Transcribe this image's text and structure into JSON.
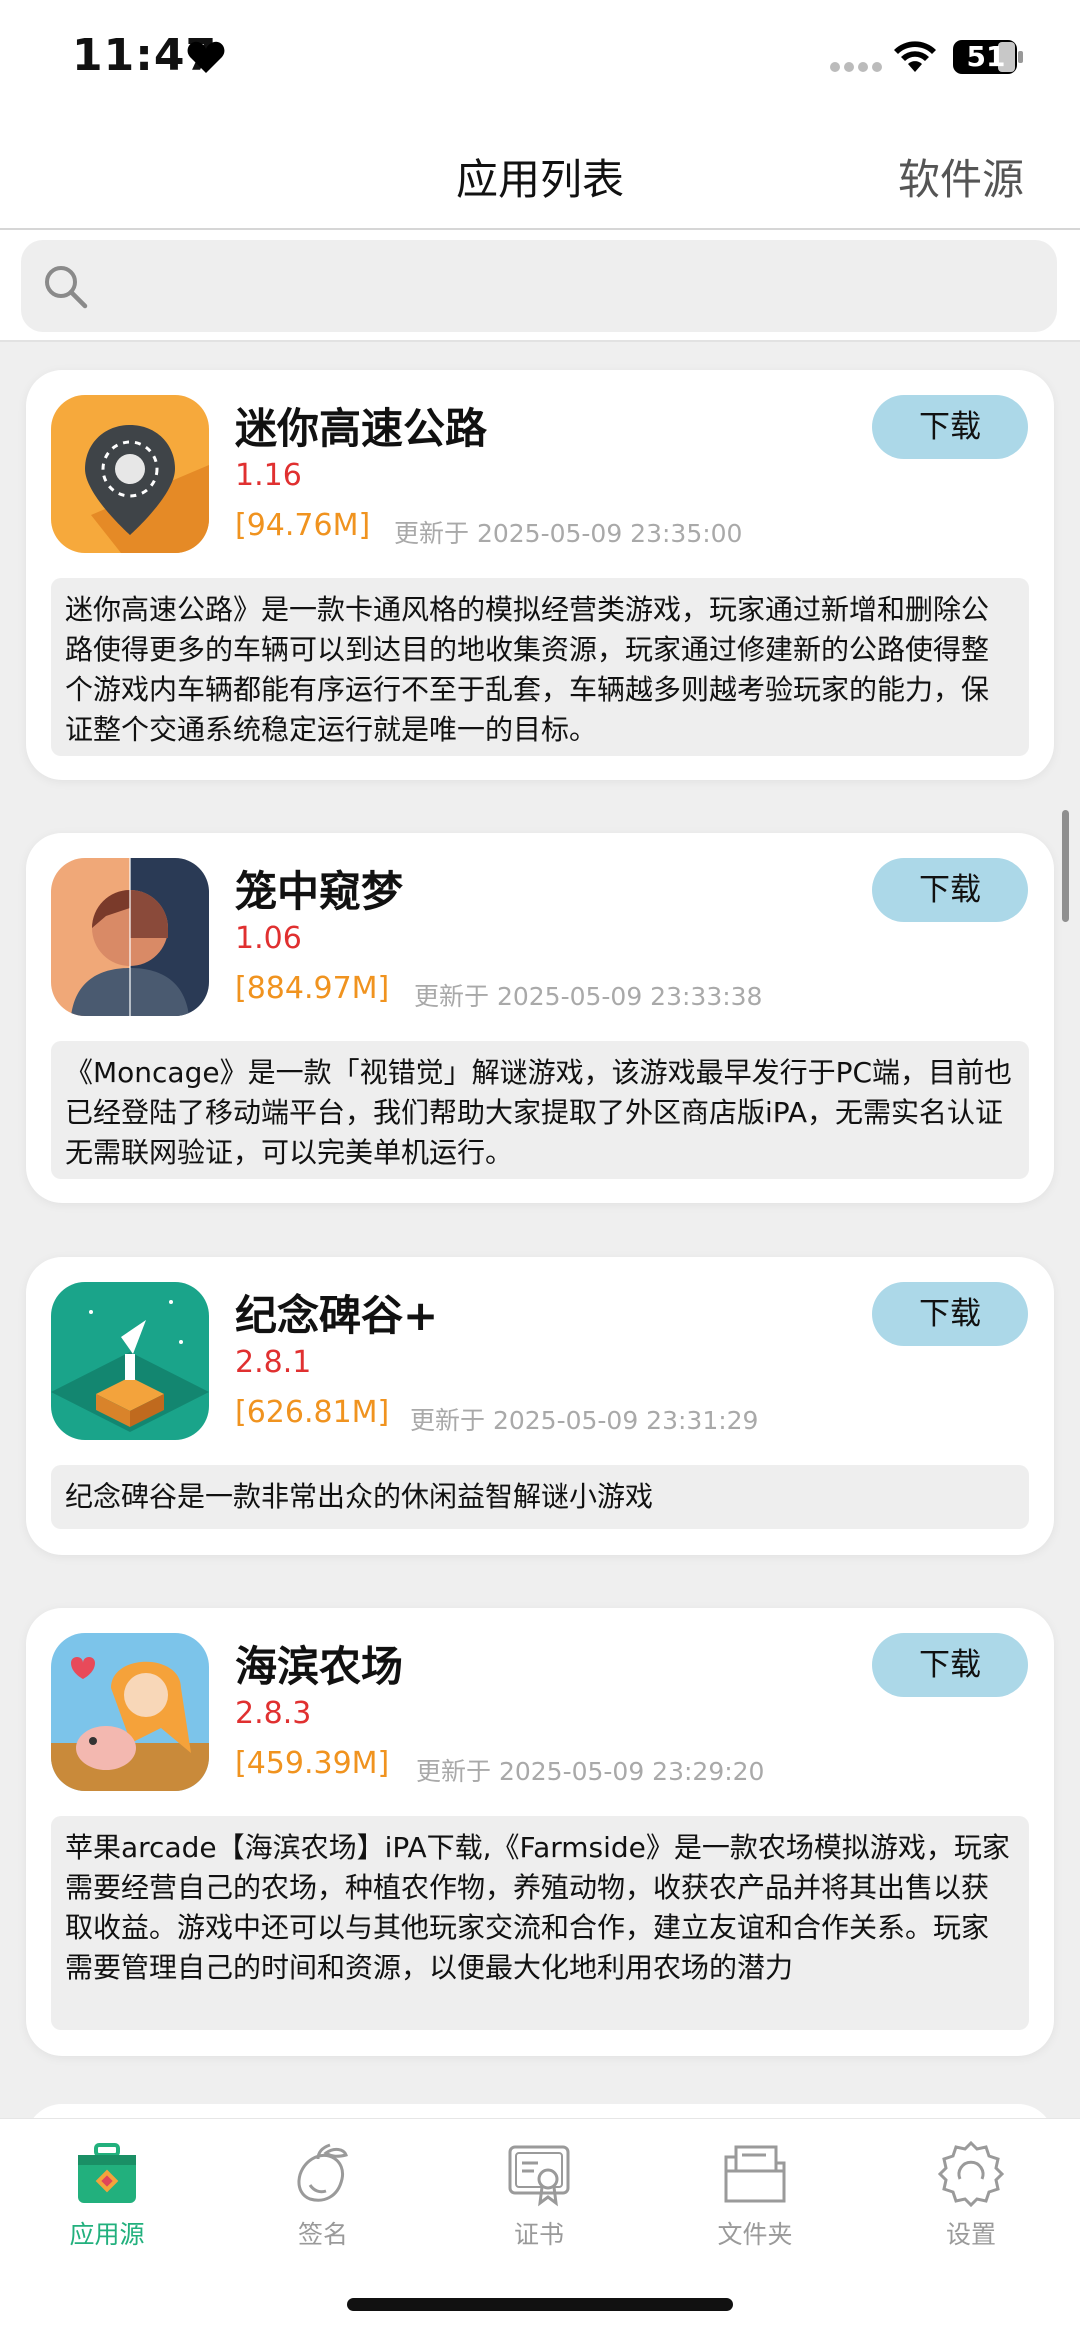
{
  "status_bar": {
    "time": "11:47",
    "battery": "51"
  },
  "nav": {
    "title": "应用列表",
    "right_label": "软件源"
  },
  "search": {
    "placeholder": ""
  },
  "apps": [
    {
      "name": "迷你高速公路",
      "version": "1.16",
      "size": "[94.76M]",
      "updated": "更新于 2025-05-09 23:35:00",
      "download_label": "下载",
      "description": "迷你高速公路》是一款卡通风格的模拟经营类游戏，玩家通过新增和删除公路使得更多的车辆可以到达目的地收集资源，玩家通过修建新的公路使得整个游戏内车辆都能有序运行不至于乱套，车辆越多则越考验玩家的能力，保证整个交通系统稳定运行就是唯一的目标。"
    },
    {
      "name": "笼中窥梦",
      "version": "1.06",
      "size": "[884.97M]",
      "updated": "更新于 2025-05-09 23:33:38",
      "download_label": "下载",
      "description": "《Moncage》是一款「视错觉」解谜游戏，该游戏最早发行于PC端，目前也已经登陆了移动端平台，我们帮助大家提取了外区商店版iPA，无需实名认证无需联网验证，可以完美单机运行。"
    },
    {
      "name": "纪念碑谷+",
      "version": "2.8.1",
      "size": "[626.81M]",
      "updated": "更新于 2025-05-09 23:31:29",
      "download_label": "下载",
      "description": "纪念碑谷是一款非常出众的休闲益智解谜小游戏"
    },
    {
      "name": "海滨农场",
      "version": "2.8.3",
      "size": "[459.39M]",
      "updated": "更新于 2025-05-09 23:29:20",
      "download_label": "下载",
      "description": "苹果arcade【海滨农场】iPA下载,《Farmside》是一款农场模拟游戏，玩家需要经营自己的农场，种植农作物，养殖动物，收获农产品并将其出售以获取收益。游戏中还可以与其他玩家交流和合作，建立友谊和合作关系。玩家需要管理自己的时间和资源，以便最大化地利用农场的潜力"
    }
  ],
  "tabs": [
    {
      "label": "应用源",
      "icon": "toolbox-icon",
      "active": true
    },
    {
      "label": "签名",
      "icon": "mango-icon",
      "active": false
    },
    {
      "label": "证书",
      "icon": "certificate-icon",
      "active": false
    },
    {
      "label": "文件夹",
      "icon": "folder-icon",
      "active": false
    },
    {
      "label": "设置",
      "icon": "gear-icon",
      "active": false
    }
  ],
  "colors": {
    "accent": "#22b07d",
    "version": "#e03030",
    "size": "#f0931f",
    "download_button": "#acd8e8"
  }
}
